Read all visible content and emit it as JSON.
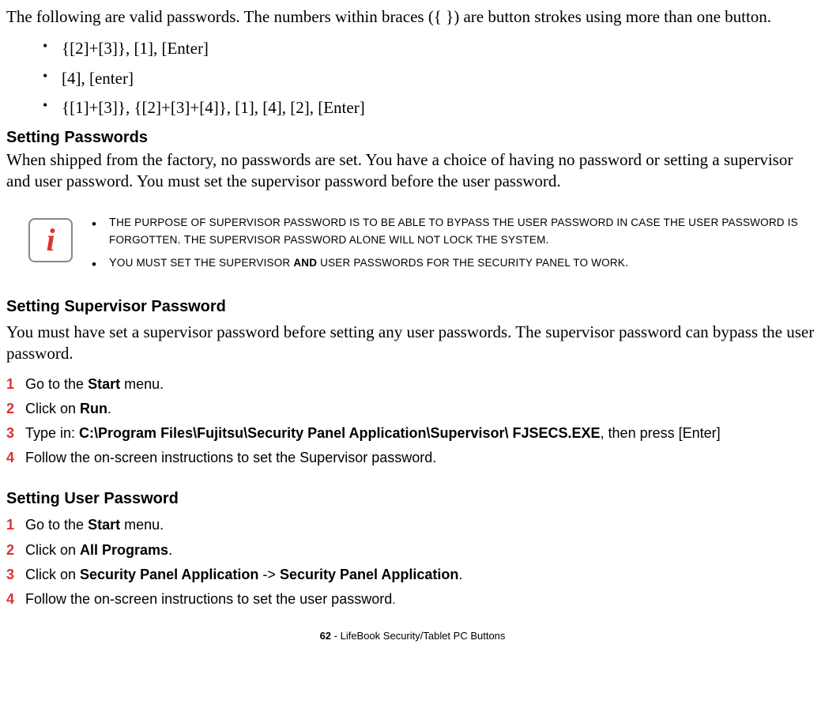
{
  "intro": "The following are valid passwords. The numbers within braces ({  }) are button strokes using more than one button.",
  "examples": [
    "{[2]+[3]}, [1], [Enter]",
    "[4], [enter]",
    "{[1]+[3]}, {[2]+[3]+[4]}, [1], [4], [2], [Enter]"
  ],
  "setting_passwords_heading": "Setting Passwords",
  "setting_passwords_body": "When shipped from the factory, no passwords are set. You have a choice of having no password or setting a supervisor and user password. You must set the supervisor password before the user password.",
  "info_notes": {
    "note1_part1": "T",
    "note1_part2": "HE PURPOSE OF SUPERVISOR PASSWORD IS TO BE ABLE TO BYPASS THE USER PASSWORD IN CASE THE USER PASSWORD IS FORGOTTEN",
    "note1_part3": ". T",
    "note1_part4": "HE SUPERVISOR PASSWORD ALONE WILL NOT LOCK THE SYSTEM",
    "note1_part5": ".",
    "note2_part1": "Y",
    "note2_part2": "OU MUST SET THE SUPERVISOR ",
    "note2_and": "AND",
    "note2_part3": " USER PASSWORDS FOR THE SECURITY PANEL TO WORK",
    "note2_part4": "."
  },
  "setting_supervisor_heading": "Setting Supervisor Password",
  "setting_supervisor_body": "You must have set a supervisor password before setting any user passwords. The supervisor password can bypass the user password.",
  "sup_steps": {
    "s1a": "Go to the ",
    "s1b": "Start",
    "s1c": " menu.",
    "s2a": "Click on ",
    "s2b": "Run",
    "s2c": ".",
    "s3a": "Type in: ",
    "s3b": "C:\\Program Files\\Fujitsu\\Security Panel Application\\Supervisor\\ FJSECS.EXE",
    "s3c": ", then press [Enter]",
    "s4": "Follow the on-screen instructions to set the Supervisor password."
  },
  "setting_user_heading": "Setting User Password",
  "user_steps": {
    "s1a": "Go to the ",
    "s1b": "Start",
    "s1c": " menu.",
    "s2a": "Click on ",
    "s2b": "All Programs",
    "s2c": ".",
    "s3a": "Click on ",
    "s3b": "Security Panel Application",
    "s3c": " -> ",
    "s3d": "Security Panel Application",
    "s3e": ".",
    "s4a": "Follow the on-screen instructions to set the user password",
    "s4b": "."
  },
  "footer_page": "62",
  "footer_text": " - LifeBook Security/Tablet PC Buttons"
}
